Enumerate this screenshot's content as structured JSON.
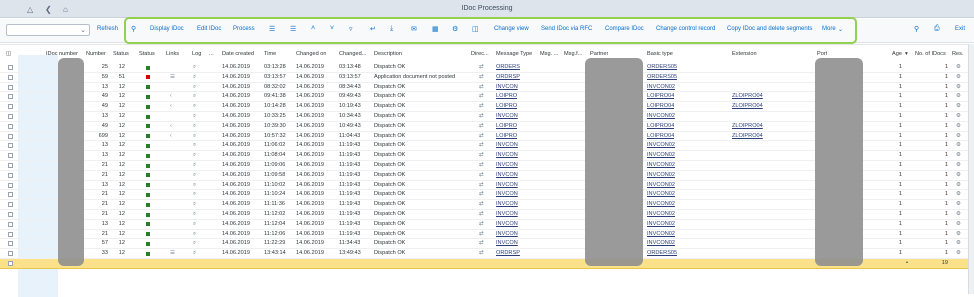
{
  "shell": {
    "title": "IDoc Processing"
  },
  "toolbar": {
    "refresh": "Refresh",
    "display_idoc": "Display IDoc",
    "edit_idoc": "Edit IDoc",
    "process": "Process",
    "change_view": "Change view",
    "send_rfc": "Send IDoc via RFC",
    "compare_idoc": "Compare IDoc",
    "change_control": "Change control record",
    "copy_delete": "Copy IDoc and delete segments",
    "more": "More",
    "exit": "Exit"
  },
  "columns": {
    "idoc_number": "IDoc number",
    "number": "Number",
    "status": "Status",
    "status2": "Status",
    "links": "Links",
    "log": "Log",
    "dots": "...",
    "date_created": "Date created",
    "time": "Time",
    "changed_on": "Changed on",
    "changed_dots": "Changed...",
    "description": "Description",
    "direction": "Direc...",
    "message_type": "Message Type",
    "msg": "Msg. ...",
    "msgf": "Msg.f...",
    "partner": "Partner",
    "basic_type": "Basic type",
    "extension": "Extension",
    "port": "Port",
    "age": "Age",
    "no_idocs": "No. of IDocs",
    "res": "Res."
  },
  "rows": [
    {
      "number": "25",
      "status": "12",
      "light": "ok",
      "links": "",
      "date": "14.06.2019",
      "time": "03:13:28",
      "changed": "14.06.2019",
      "ctime": "03:13:48",
      "desc": "Dispatch OK",
      "msgtype": "ORDERS",
      "basic": "ORDERS05",
      "ext": "",
      "age": "1",
      "count": "1"
    },
    {
      "number": "59",
      "status": "51",
      "light": "err",
      "links": "",
      "date": "14.06.2019",
      "time": "03:13:57",
      "changed": "14.06.2019",
      "ctime": "03:13:57",
      "desc": "Application document not posted",
      "msgtype": "ORDRSP",
      "basic": "ORDERS05",
      "ext": "",
      "age": "1",
      "count": "1"
    },
    {
      "number": "13",
      "status": "12",
      "light": "ok",
      "links": "",
      "date": "14.06.2019",
      "time": "08:32:02",
      "changed": "14.06.2019",
      "ctime": "08:34:43",
      "desc": "Dispatch OK",
      "msgtype": "INVCON",
      "basic": "INVCON02",
      "ext": "",
      "age": "1",
      "count": "1"
    },
    {
      "number": "49",
      "status": "12",
      "light": "ok",
      "links": "",
      "date": "14.06.2019",
      "time": "09:41:38",
      "changed": "14.06.2019",
      "ctime": "09:49:43",
      "desc": "Dispatch OK",
      "msgtype": "LOIPRO",
      "basic": "LOIPRO04",
      "ext": "ZLOIPRO04",
      "age": "1",
      "count": "1"
    },
    {
      "number": "49",
      "status": "12",
      "light": "ok",
      "links": "",
      "date": "14.06.2019",
      "time": "10:14:28",
      "changed": "14.06.2019",
      "ctime": "10:19:43",
      "desc": "Dispatch OK",
      "msgtype": "LOIPRO",
      "basic": "LOIPRO04",
      "ext": "ZLOIPRO04",
      "age": "1",
      "count": "1"
    },
    {
      "number": "13",
      "status": "12",
      "light": "ok",
      "links": "",
      "date": "14.06.2019",
      "time": "10:33:25",
      "changed": "14.06.2019",
      "ctime": "10:34:43",
      "desc": "Dispatch OK",
      "msgtype": "INVCON",
      "basic": "INVCON02",
      "ext": "",
      "age": "1",
      "count": "1"
    },
    {
      "number": "49",
      "status": "12",
      "light": "ok",
      "links": "",
      "date": "14.06.2019",
      "time": "10:39:30",
      "changed": "14.06.2019",
      "ctime": "10:49:43",
      "desc": "Dispatch OK",
      "msgtype": "LOIPRO",
      "basic": "LOIPRO04",
      "ext": "ZLOIPRO04",
      "age": "1",
      "count": "1"
    },
    {
      "number": "699",
      "status": "12",
      "light": "ok",
      "links": "",
      "date": "14.06.2019",
      "time": "10:57:32",
      "changed": "14.06.2019",
      "ctime": "11:04:43",
      "desc": "Dispatch OK",
      "msgtype": "LOIPRO",
      "basic": "LOIPRO04",
      "ext": "ZLOIPRO04",
      "age": "1",
      "count": "1"
    },
    {
      "number": "13",
      "status": "12",
      "light": "ok",
      "links": "",
      "date": "14.06.2019",
      "time": "11:06:02",
      "changed": "14.06.2019",
      "ctime": "11:19:43",
      "desc": "Dispatch OK",
      "msgtype": "INVCON",
      "basic": "INVCON02",
      "ext": "",
      "age": "1",
      "count": "1"
    },
    {
      "number": "13",
      "status": "12",
      "light": "ok",
      "links": "",
      "date": "14.06.2019",
      "time": "11:08:04",
      "changed": "14.06.2019",
      "ctime": "11:19:43",
      "desc": "Dispatch OK",
      "msgtype": "INVCON",
      "basic": "INVCON02",
      "ext": "",
      "age": "1",
      "count": "1"
    },
    {
      "number": "21",
      "status": "12",
      "light": "ok",
      "links": "",
      "date": "14.06.2019",
      "time": "11:09:06",
      "changed": "14.06.2019",
      "ctime": "11:19:43",
      "desc": "Dispatch OK",
      "msgtype": "INVCON",
      "basic": "INVCON02",
      "ext": "",
      "age": "1",
      "count": "1"
    },
    {
      "number": "21",
      "status": "12",
      "light": "ok",
      "links": "",
      "date": "14.06.2019",
      "time": "11:09:58",
      "changed": "14.06.2019",
      "ctime": "11:19:43",
      "desc": "Dispatch OK",
      "msgtype": "INVCON",
      "basic": "INVCON02",
      "ext": "",
      "age": "1",
      "count": "1"
    },
    {
      "number": "13",
      "status": "12",
      "light": "ok",
      "links": "",
      "date": "14.06.2019",
      "time": "11:10:02",
      "changed": "14.06.2019",
      "ctime": "11:19:43",
      "desc": "Dispatch OK",
      "msgtype": "INVCON",
      "basic": "INVCON02",
      "ext": "",
      "age": "1",
      "count": "1"
    },
    {
      "number": "21",
      "status": "12",
      "light": "ok",
      "links": "",
      "date": "14.06.2019",
      "time": "11:10:24",
      "changed": "14.06.2019",
      "ctime": "11:19:43",
      "desc": "Dispatch OK",
      "msgtype": "INVCON",
      "basic": "INVCON02",
      "ext": "",
      "age": "1",
      "count": "1"
    },
    {
      "number": "21",
      "status": "12",
      "light": "ok",
      "links": "",
      "date": "14.06.2019",
      "time": "11:11:36",
      "changed": "14.06.2019",
      "ctime": "11:19:43",
      "desc": "Dispatch OK",
      "msgtype": "INVCON",
      "basic": "INVCON02",
      "ext": "",
      "age": "1",
      "count": "1"
    },
    {
      "number": "21",
      "status": "12",
      "light": "ok",
      "links": "",
      "date": "14.06.2019",
      "time": "11:12:02",
      "changed": "14.06.2019",
      "ctime": "11:19:43",
      "desc": "Dispatch OK",
      "msgtype": "INVCON",
      "basic": "INVCON02",
      "ext": "",
      "age": "1",
      "count": "1"
    },
    {
      "number": "13",
      "status": "12",
      "light": "ok",
      "links": "",
      "date": "14.06.2019",
      "time": "11:12:04",
      "changed": "14.06.2019",
      "ctime": "11:19:43",
      "desc": "Dispatch OK",
      "msgtype": "INVCON",
      "basic": "INVCON02",
      "ext": "",
      "age": "1",
      "count": "1"
    },
    {
      "number": "21",
      "status": "12",
      "light": "ok",
      "links": "",
      "date": "14.06.2019",
      "time": "11:12:06",
      "changed": "14.06.2019",
      "ctime": "11:19:43",
      "desc": "Dispatch OK",
      "msgtype": "INVCON",
      "basic": "INVCON02",
      "ext": "",
      "age": "1",
      "count": "1"
    },
    {
      "number": "57",
      "status": "12",
      "light": "ok",
      "links": "",
      "date": "14.06.2019",
      "time": "11:22:29",
      "changed": "14.06.2019",
      "ctime": "11:34:43",
      "desc": "Dispatch OK",
      "msgtype": "INVCON",
      "basic": "INVCON02",
      "ext": "",
      "age": "1",
      "count": "1"
    },
    {
      "number": "33",
      "status": "12",
      "light": "ok",
      "links": "",
      "date": "14.06.2019",
      "time": "13:43:14",
      "changed": "14.06.2019",
      "ctime": "13:49:43",
      "desc": "Dispatch OK",
      "msgtype": "ORDRSP",
      "basic": "ORDERS05",
      "ext": "",
      "age": "1",
      "count": "1"
    }
  ],
  "totals": {
    "marker": "•",
    "count": "19"
  },
  "colors": {
    "highlight": "#92d050",
    "total_row": "#fbe28a",
    "ok": "#2b7d2b",
    "error": "#d60000"
  }
}
